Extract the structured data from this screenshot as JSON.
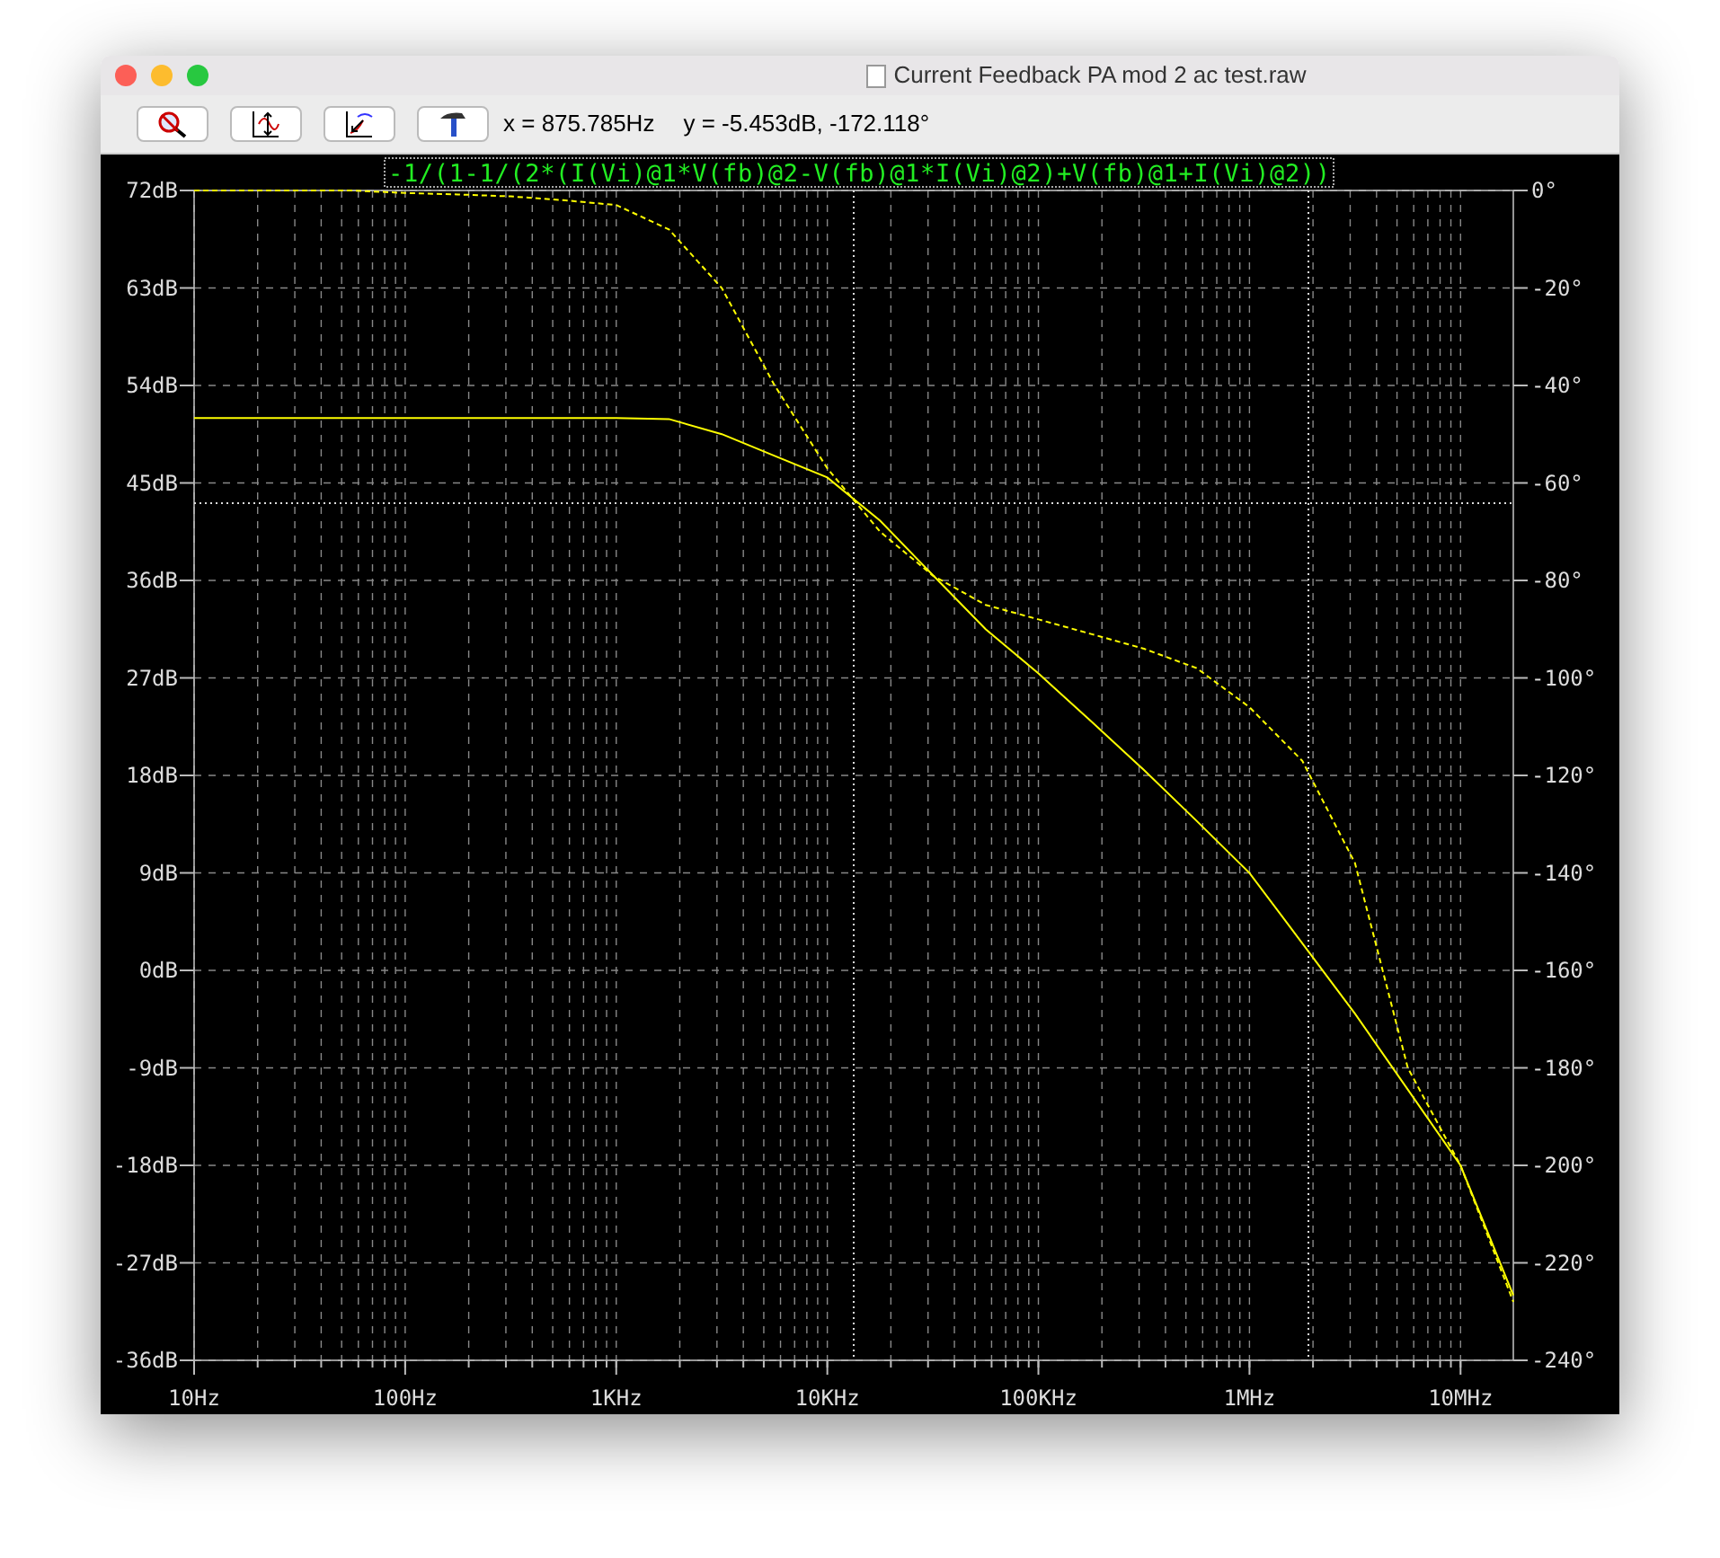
{
  "window": {
    "title": "Current Feedback PA mod 2 ac test.raw"
  },
  "toolbar": {
    "buttons": [
      {
        "kind": "zoom-cancel"
      },
      {
        "kind": "autoscale"
      },
      {
        "kind": "pan"
      },
      {
        "kind": "hammer"
      }
    ],
    "x_readout": "x = 875.785Hz",
    "y_readout": "y = -5.453dB, -172.118°"
  },
  "plot": {
    "chart_data": {
      "type": "line",
      "title": "-1/(1-1/(2*(I(Vi)@1*V(fb)@2-V(fb)@1*I(Vi)@2)+V(fb)@1+I(Vi)@2))",
      "categories": [
        "10Hz",
        null,
        null,
        null,
        "100Hz",
        null,
        null,
        null,
        "1KHz",
        null,
        null,
        null,
        "10KHz",
        null,
        null,
        null,
        "100KHz",
        null,
        null,
        null,
        "1MHz",
        null,
        null,
        null,
        "10MHz",
        null
      ],
      "series": [
        {
          "color": "#ffff00",
          "values": [
            51,
            51,
            51,
            51,
            51,
            51,
            51,
            51,
            51,
            50.9,
            49.5,
            47.5,
            45.5,
            41.5,
            36.5,
            31.5,
            27.4,
            23,
            18.5,
            13.8,
            9,
            2.5,
            -4,
            -11,
            -18,
            -30
          ]
        },
        {
          "color": "#ffff00",
          "axis": "y2",
          "line_style": "dashed",
          "values": [
            0,
            0,
            0,
            0,
            -0.5,
            -0.8,
            -1.2,
            -2,
            -3,
            -8,
            -20,
            -40,
            -57,
            -70,
            -79,
            -85,
            -88,
            -91,
            -94,
            -98,
            -106,
            -117,
            -138,
            -180,
            -200,
            -228
          ]
        }
      ],
      "grid": true,
      "ylim": [
        -36,
        72
      ],
      "y2lim": [
        -240,
        0
      ],
      "yticks": [
        {
          "value": 72,
          "label": "72dB"
        },
        {
          "value": 63,
          "label": "63dB"
        },
        {
          "value": 54,
          "label": "54dB"
        },
        {
          "value": 45,
          "label": "45dB"
        },
        {
          "value": 36,
          "label": "36dB"
        },
        {
          "value": 27,
          "label": "27dB"
        },
        {
          "value": 18,
          "label": "18dB"
        },
        {
          "value": 9,
          "label": "9dB"
        },
        {
          "value": 0,
          "label": "0dB"
        },
        {
          "value": -9,
          "label": "-9dB"
        },
        {
          "value": -18,
          "label": "-18dB"
        },
        {
          "value": -27,
          "label": "-27dB"
        },
        {
          "value": -36,
          "label": "-36dB"
        }
      ],
      "y2ticks": [
        {
          "value": 0,
          "label": "0°"
        },
        {
          "value": -20,
          "label": "-20°"
        },
        {
          "value": -40,
          "label": "-40°"
        },
        {
          "value": -60,
          "label": "-60°"
        },
        {
          "value": -80,
          "label": "-80°"
        },
        {
          "value": -100,
          "label": "-100°"
        },
        {
          "value": -120,
          "label": "-120°"
        },
        {
          "value": -140,
          "label": "-140°"
        },
        {
          "value": -160,
          "label": "-160°"
        },
        {
          "value": -180,
          "label": "-180°"
        },
        {
          "value": -200,
          "label": "-200°"
        },
        {
          "value": -220,
          "label": "-220°"
        },
        {
          "value": -240,
          "label": "-240°"
        }
      ]
    }
  }
}
